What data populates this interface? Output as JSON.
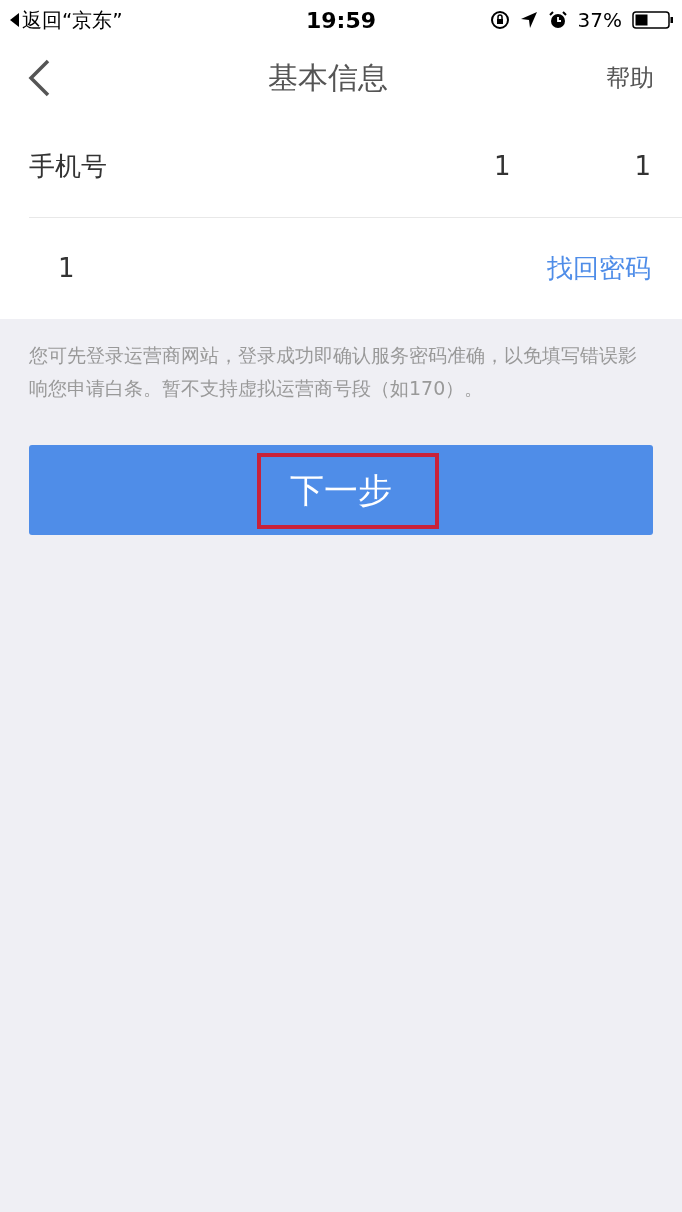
{
  "status_bar": {
    "back_app": "返回“京东”",
    "time": "19:59",
    "battery": "37%"
  },
  "nav": {
    "title": "基本信息",
    "action": "帮助"
  },
  "rows": [
    {
      "label": "手机号",
      "values": [
        "1",
        "1"
      ]
    },
    {
      "label": "1",
      "link": "找回密码"
    }
  ],
  "note": "您可先登录运营商网站，登录成功即确认服务密码准确，以免填写错误影响您申请白条。暂不支持虚拟运营商号段（如170）。",
  "button": {
    "label": "下一步",
    "highlighted": true
  }
}
